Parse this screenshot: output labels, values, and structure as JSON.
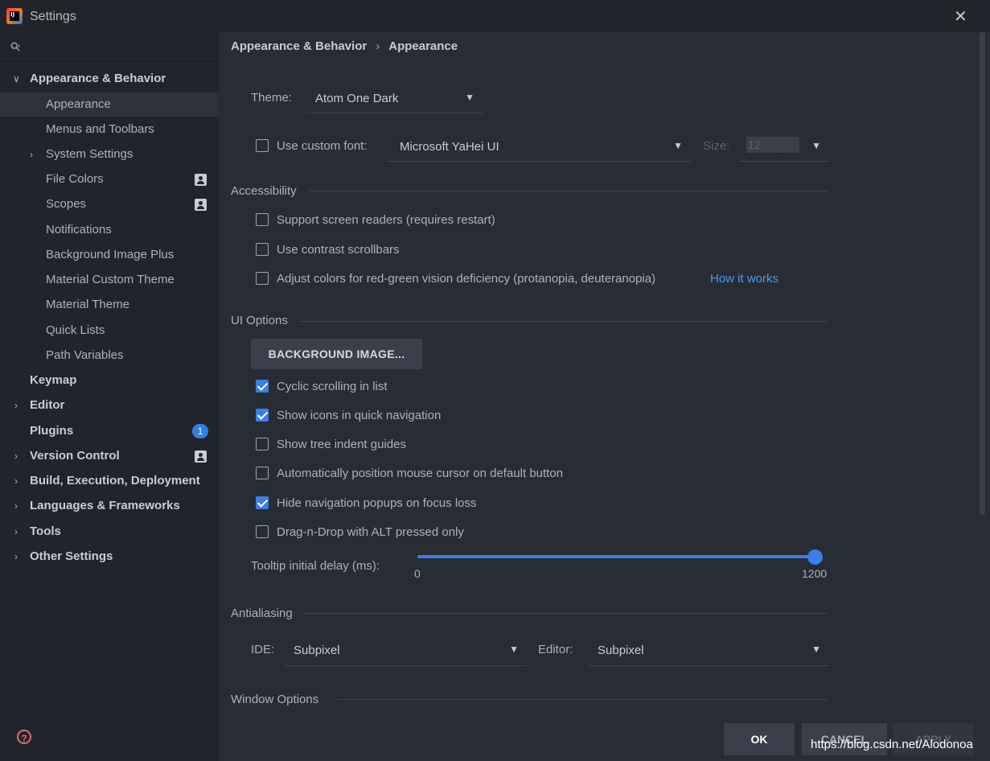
{
  "window": {
    "title": "Settings"
  },
  "sidebar": {
    "items": [
      {
        "label": "Appearance & Behavior",
        "expanded": true
      },
      {
        "label": "Appearance"
      },
      {
        "label": "Menus and Toolbars"
      },
      {
        "label": "System Settings"
      },
      {
        "label": "File Colors"
      },
      {
        "label": "Scopes"
      },
      {
        "label": "Notifications"
      },
      {
        "label": "Background Image Plus"
      },
      {
        "label": "Material Custom Theme"
      },
      {
        "label": "Material Theme"
      },
      {
        "label": "Quick Lists"
      },
      {
        "label": "Path Variables"
      },
      {
        "label": "Keymap"
      },
      {
        "label": "Editor"
      },
      {
        "label": "Plugins",
        "badge": "1"
      },
      {
        "label": "Version Control"
      },
      {
        "label": "Build, Execution, Deployment"
      },
      {
        "label": "Languages & Frameworks"
      },
      {
        "label": "Tools"
      },
      {
        "label": "Other Settings"
      }
    ]
  },
  "breadcrumb": {
    "parent": "Appearance & Behavior",
    "separator": "›",
    "current": "Appearance"
  },
  "theme": {
    "label": "Theme:",
    "value": "Atom One Dark"
  },
  "font": {
    "label": "Use custom font:",
    "value": "Microsoft YaHei UI",
    "size_label": "Size:",
    "size_value": "12",
    "checked": false
  },
  "accessibility": {
    "title": "Accessibility",
    "options": [
      {
        "label": "Support screen readers (requires restart)",
        "checked": false
      },
      {
        "label": "Use contrast scrollbars",
        "checked": false
      },
      {
        "label": "Adjust colors for red-green vision deficiency (protanopia, deuteranopia)",
        "checked": false
      }
    ],
    "link": "How it works"
  },
  "ui_options": {
    "title": "UI Options",
    "button": "BACKGROUND IMAGE...",
    "options": [
      {
        "label": "Cyclic scrolling in list",
        "checked": true
      },
      {
        "label": "Show icons in quick navigation",
        "checked": true
      },
      {
        "label": "Show tree indent guides",
        "checked": false
      },
      {
        "label": "Automatically position mouse cursor on default button",
        "checked": false
      },
      {
        "label": "Hide navigation popups on focus loss",
        "checked": true
      },
      {
        "label": "Drag-n-Drop with ALT pressed only",
        "checked": false
      }
    ],
    "tooltip": {
      "label": "Tooltip initial delay (ms):",
      "min": "0",
      "max": "1200",
      "value": 1200
    }
  },
  "antialiasing": {
    "title": "Antialiasing",
    "ide_label": "IDE:",
    "ide_value": "Subpixel",
    "editor_label": "Editor:",
    "editor_value": "Subpixel"
  },
  "window_options": {
    "title": "Window Options"
  },
  "footer": {
    "ok": "OK",
    "cancel": "CANCEL",
    "apply": "APPLY"
  },
  "watermark": "https://blog.csdn.net/Alodonoa",
  "colors": {
    "accent": "#3d7ee8",
    "link": "#4d9bf0",
    "background": "#282c34",
    "sidebar": "#21252b"
  }
}
